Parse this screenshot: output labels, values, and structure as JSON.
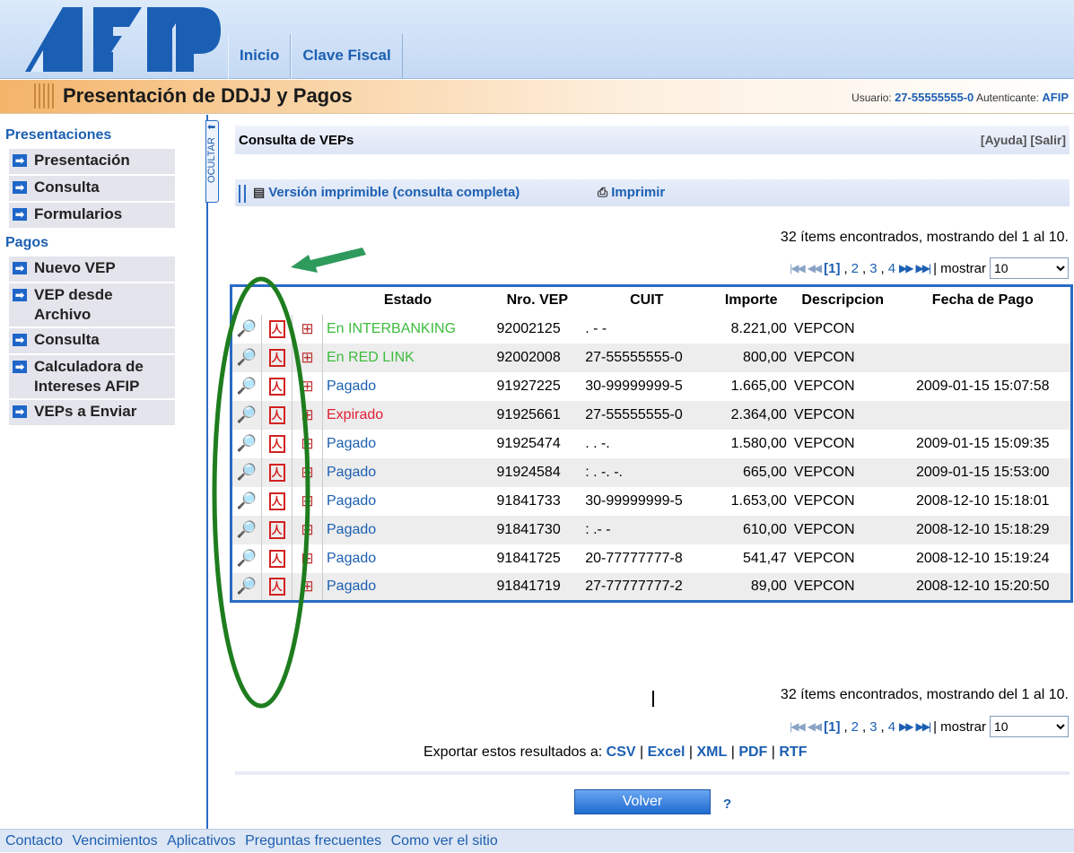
{
  "header": {
    "logo_text": "AFIP",
    "nav": [
      "Inicio",
      "Clave Fiscal"
    ]
  },
  "titlebar": {
    "title": "Presentación de DDJJ y Pagos",
    "user_label": "Usuario:",
    "user_value": "27-55555555-0",
    "auth_label": "Autenticante:",
    "auth_value": "AFIP"
  },
  "sidebar": {
    "presentaciones_title": "Presentaciones",
    "presentaciones_items": [
      "Presentación",
      "Consulta",
      "Formularios"
    ],
    "pagos_title": "Pagos",
    "pagos_items": [
      "Nuevo VEP",
      "VEP desde Archivo",
      "Consulta",
      "Calculadora de Intereses AFIP",
      "VEPs a Enviar"
    ],
    "ocultar": "OCULTAR"
  },
  "main": {
    "section_title": "Consulta de VEPs",
    "help_link": "[Ayuda]",
    "exit_link": "[Salir]",
    "print_version_link": "Versión imprimible (consulta completa)",
    "print_link": "Imprimir",
    "count_text": "32 ítems encontrados, mostrando del 1 al 10.",
    "pager": {
      "current": "[1]",
      "pages": [
        "2",
        "3",
        "4"
      ],
      "show_label": "| mostrar",
      "page_size": "10"
    }
  },
  "table": {
    "columns": [
      "Estado",
      "Nro. VEP",
      "CUIT",
      "Importe",
      "Descripcion",
      "Fecha de Pago"
    ],
    "rows": [
      {
        "estado": "En INTERBANKING",
        "estado_color": "#3dbb3d",
        "nro": "92002125",
        "cuit": ".  -                    -",
        "importe": "8.221,00",
        "desc": "VEPCON",
        "fecha": ""
      },
      {
        "estado": "En RED LINK",
        "estado_color": "#3dbb3d",
        "nro": "92002008",
        "cuit": "27-55555555-0",
        "importe": "800,00",
        "desc": "VEPCON",
        "fecha": ""
      },
      {
        "estado": "Pagado",
        "estado_color": "#1c5fb2",
        "nro": "91927225",
        "cuit": "30-99999999-5",
        "importe": "1.665,00",
        "desc": "VEPCON",
        "fecha": "2009-01-15 15:07:58"
      },
      {
        "estado": "Expirado",
        "estado_color": "#e21c32",
        "nro": "91925661",
        "cuit": "27-55555555-0",
        "importe": "2.364,00",
        "desc": "VEPCON",
        "fecha": ""
      },
      {
        "estado": "Pagado",
        "estado_color": "#1c5fb2",
        "nro": "91925474",
        "cuit": ". .               -.",
        "importe": "1.580,00",
        "desc": "VEPCON",
        "fecha": "2009-01-15 15:09:35"
      },
      {
        "estado": "Pagado",
        "estado_color": "#1c5fb2",
        "nro": "91924584",
        "cuit": ": . -.               -.",
        "importe": "665,00",
        "desc": "VEPCON",
        "fecha": "2009-01-15 15:53:00"
      },
      {
        "estado": "Pagado",
        "estado_color": "#1c5fb2",
        "nro": "91841733",
        "cuit": "30-99999999-5",
        "importe": "1.653,00",
        "desc": "VEPCON",
        "fecha": "2008-12-10 15:18:01"
      },
      {
        "estado": "Pagado",
        "estado_color": "#1c5fb2",
        "nro": "91841730",
        "cuit": ": .-                 -",
        "importe": "610,00",
        "desc": "VEPCON",
        "fecha": "2008-12-10 15:18:29"
      },
      {
        "estado": "Pagado",
        "estado_color": "#1c5fb2",
        "nro": "91841725",
        "cuit": "20-77777777-8",
        "importe": "541,47",
        "desc": "VEPCON",
        "fecha": "2008-12-10 15:19:24"
      },
      {
        "estado": "Pagado",
        "estado_color": "#1c5fb2",
        "nro": "91841719",
        "cuit": "27-77777777-2",
        "importe": "89,00",
        "desc": "VEPCON",
        "fecha": "2008-12-10 15:20:50"
      }
    ]
  },
  "export": {
    "label": "Exportar estos resultados a:",
    "formats": [
      "CSV",
      "Excel",
      "XML",
      "PDF",
      "RTF"
    ]
  },
  "volver_label": "Volver",
  "help_q": "?",
  "footer": [
    "Contacto",
    "Vencimientos",
    "Aplicativos",
    "Preguntas frecuentes",
    "Como ver el sitio"
  ],
  "colors": {
    "accent": "#1c5fb2",
    "annotation": "#1e7d1e"
  }
}
